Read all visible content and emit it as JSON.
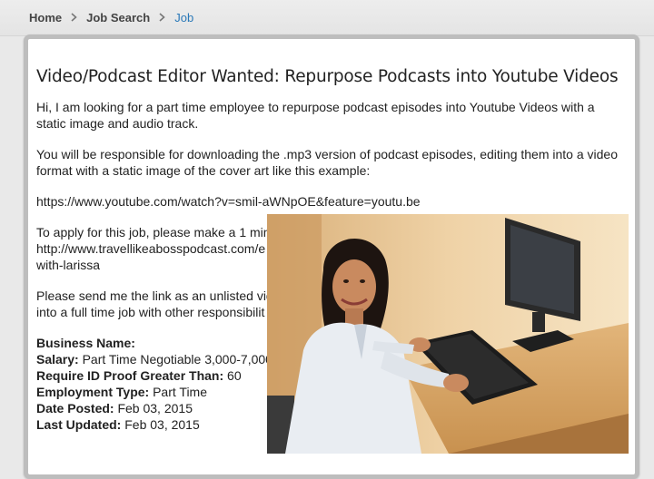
{
  "breadcrumb": {
    "items": [
      {
        "label": "Home"
      },
      {
        "label": "Job Search"
      },
      {
        "label": "Job"
      }
    ]
  },
  "job": {
    "title": "Video/Podcast Editor Wanted: Repurpose Podcasts into Youtube Videos",
    "para1": "Hi, I am looking for a part time employee to repurpose podcast episodes into Youtube Videos with a static image and audio track.",
    "para2": "You will be responsible for downloading the .mp3 version of podcast episodes, editing them into a video format with a static image of the cover art like this example:",
    "example_link": "https://www.youtube.com/watch?v=smil-aWNpOE&feature=youtu.be",
    "para3_line1": "To apply for this job, please make a 1 minu",
    "para3_line2": "http://www.travellikeabosspodcast.com/e",
    "para3_line3": "with-larissa",
    "para4_line1": "Please send me the link as an unlisted vide",
    "para4_line2": "into a full time job with other responsibilit",
    "details": [
      {
        "label": "Business Name:",
        "value": ""
      },
      {
        "label": "Salary:",
        "value": "Part Time Negotiable 3,000-7,000 I"
      },
      {
        "label": "Require ID Proof Greater Than:",
        "value": "60"
      },
      {
        "label": "Employment Type:",
        "value": "Part Time"
      },
      {
        "label": "Date Posted:",
        "value": "Feb 03, 2015"
      },
      {
        "label": "Last Updated:",
        "value": "Feb 03, 2015"
      }
    ]
  },
  "colors": {
    "breadcrumb_active": "#2b79b8",
    "card_border": "#bdbdbd"
  },
  "icons": {
    "separator": "chevron-right-icon"
  }
}
